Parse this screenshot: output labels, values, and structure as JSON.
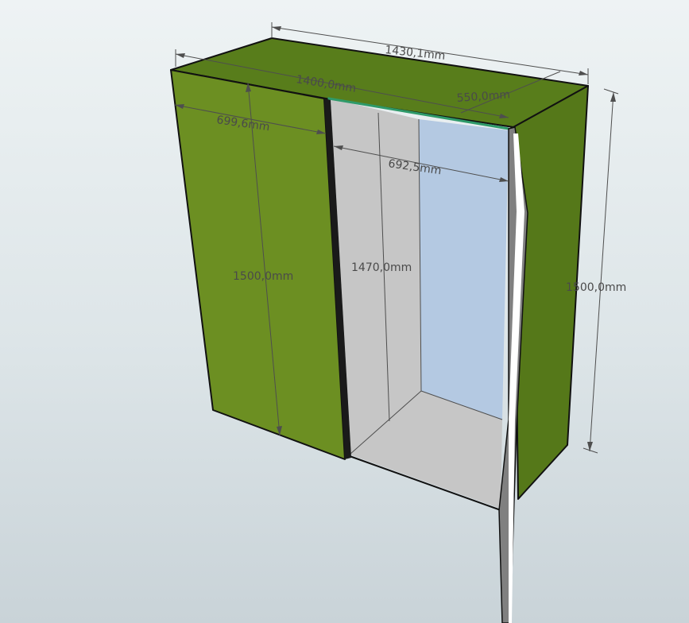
{
  "colors": {
    "panel_light": "#6c8f22",
    "panel_dark": "#557819",
    "panel_top": "#587d1b",
    "interior_grey": "#c6c6c6",
    "back_panel": "#b4c9e2",
    "edge_trim": "#2f9a6a",
    "door_edge": "#808080"
  },
  "dimensions": {
    "overall_width": "1430,1mm",
    "inner_width": "1400,0mm",
    "depth": "550,0mm",
    "left_section_width": "699,6mm",
    "opening_width": "692,5mm",
    "left_height": "1500,0mm",
    "inner_height": "1470,0mm",
    "right_height": "1500,0mm"
  }
}
